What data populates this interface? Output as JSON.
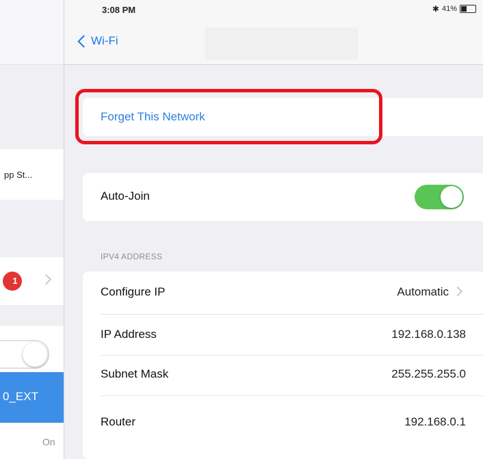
{
  "status_bar": {
    "time": "3:08 PM",
    "bluetooth_icon": "bluetooth-icon",
    "battery_percent": "41%",
    "battery_level": 0.41
  },
  "nav": {
    "back_label": "Wi-Fi",
    "back_icon": "chevron-left-icon"
  },
  "left_pane": {
    "item_app_store": "pp St...",
    "badge_count": "1",
    "selected_network": "0_EXT",
    "status_value": "On"
  },
  "forget": {
    "label": "Forget This Network",
    "highlight_color": "#e8141e"
  },
  "auto_join": {
    "label": "Auto-Join",
    "enabled": true,
    "toggle_color": "#5ac557"
  },
  "ipv4": {
    "header": "IPV4 ADDRESS",
    "configure_label": "Configure IP",
    "configure_value": "Automatic",
    "ip_label": "IP Address",
    "ip_value": "192.168.0.138",
    "subnet_label": "Subnet Mask",
    "subnet_value": "255.255.255.0",
    "router_label": "Router",
    "router_value": "192.168.0.1"
  },
  "colors": {
    "accent": "#1a7aef",
    "selected_row": "#3d8ee6",
    "badge": "#e33434"
  }
}
